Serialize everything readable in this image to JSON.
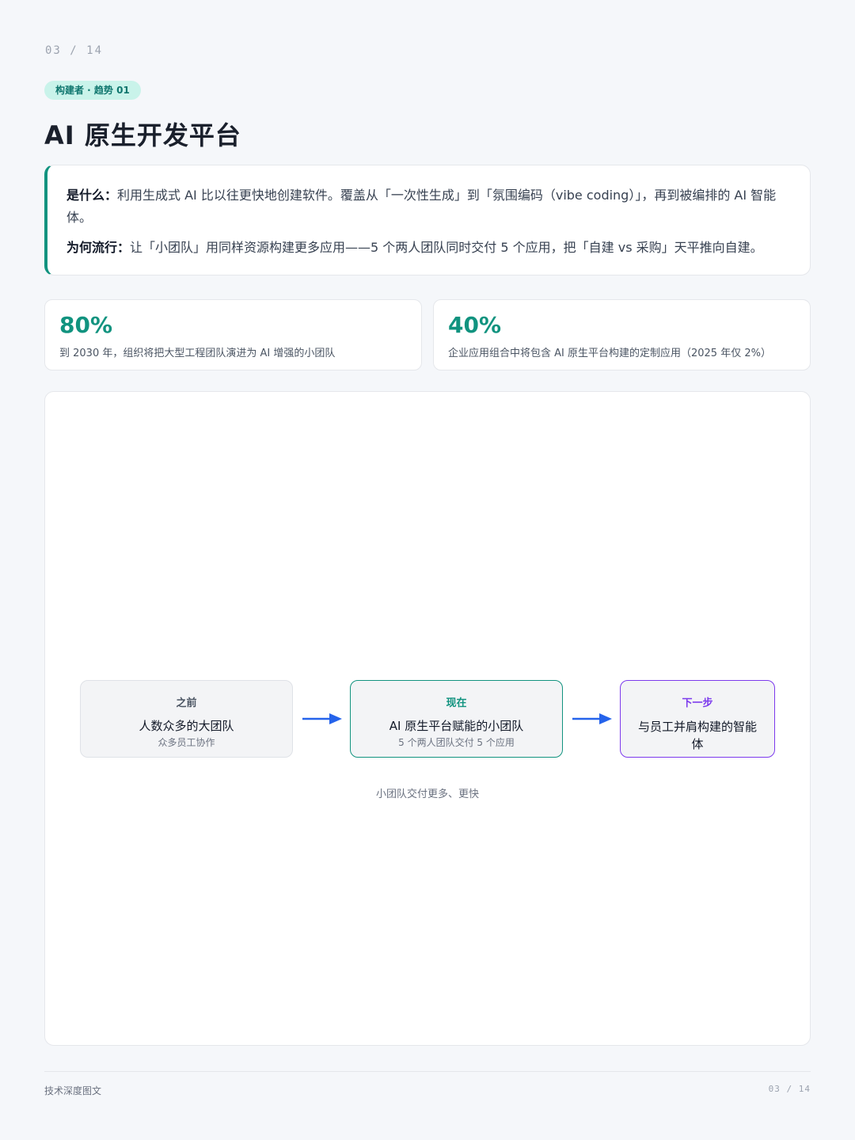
{
  "header": {
    "page_indicator": "03 / 14",
    "tag": "构建者 · 趋势 01",
    "title": "AI 原生开发平台"
  },
  "info": {
    "what_label": "是什么：",
    "what_text": "利用生成式 AI 比以往更快地创建软件。覆盖从「一次性生成」到「氛围编码（vibe coding）」，再到被编排的 AI 智能体。",
    "why_label": "为何流行：",
    "why_text": "让「小团队」用同样资源构建更多应用——5 个两人团队同时交付 5 个应用，把「自建 vs 采购」天平推向自建。"
  },
  "stats": [
    {
      "value": "80%",
      "desc": "到 2030 年，组织将把大型工程团队演进为 AI 增强的小团队"
    },
    {
      "value": "40%",
      "desc": "企业应用组合中将包含 AI 原生平台构建的定制应用（2025 年仅 2%）"
    }
  ],
  "diagram": {
    "nodes": [
      {
        "head": "之前",
        "main": "人数众多的大团队",
        "sub": "众多员工协作"
      },
      {
        "head": "现在",
        "main": "AI 原生平台赋能的小团队",
        "sub": "5 个两人团队交付 5 个应用"
      },
      {
        "head": "下一步",
        "main": "与员工并肩构建的智能体"
      }
    ],
    "caption": "小团队交付更多、更快"
  },
  "footer": {
    "left": "技术深度图文",
    "right": "03 / 14"
  },
  "colors": {
    "accent": "#11937f",
    "next": "#7c3aed",
    "arrow": "#2563eb"
  }
}
